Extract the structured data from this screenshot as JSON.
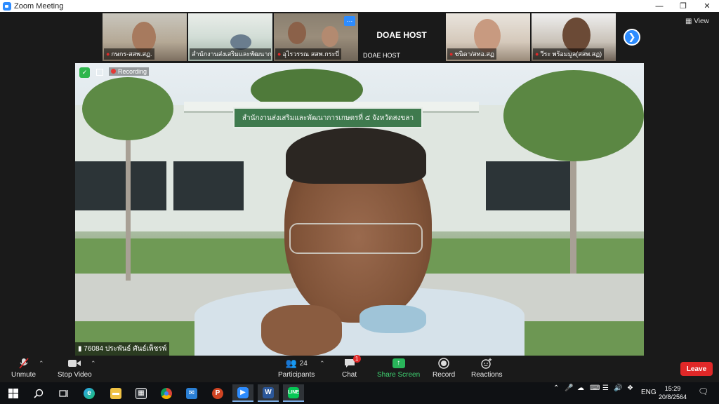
{
  "window": {
    "title": "Zoom Meeting"
  },
  "thumbnails": [
    {
      "name": "กษกร-สสพ.สฏ."
    },
    {
      "name": "สำนักงานส่งเสริมและพัฒนาก..."
    },
    {
      "name": "อุไรวรรณ สสพ.กระบี่"
    },
    {
      "name": "DOAE HOST",
      "host_label": "DOAE HOST"
    },
    {
      "name": "ชนิดา/สทอ.สฏ"
    },
    {
      "name": "วีระ พร้อมมูล(สสพ.สฏ)"
    }
  ],
  "view_label": "View",
  "main_video": {
    "recording_label": "Recording",
    "participant_name": "76084 ประพันธ์ ศันธ์เพ็ชรพ์",
    "sign_text": "สำนักงานส่งเสริมและพัฒนาการเกษตรที่ ๕ จังหวัดสงขลา"
  },
  "toolbar": {
    "unmute": "Unmute",
    "stop_video": "Stop Video",
    "participants": "Participants",
    "participants_count": "24",
    "chat": "Chat",
    "chat_badge": "1",
    "share_screen": "Share Screen",
    "record": "Record",
    "reactions": "Reactions",
    "leave": "Leave"
  },
  "taskbar": {
    "language": "ENG",
    "time": "15:29",
    "date": "20/8/2564"
  },
  "colors": {
    "accent": "#2d8cff",
    "leave": "#e02828",
    "share": "#29b55a"
  }
}
